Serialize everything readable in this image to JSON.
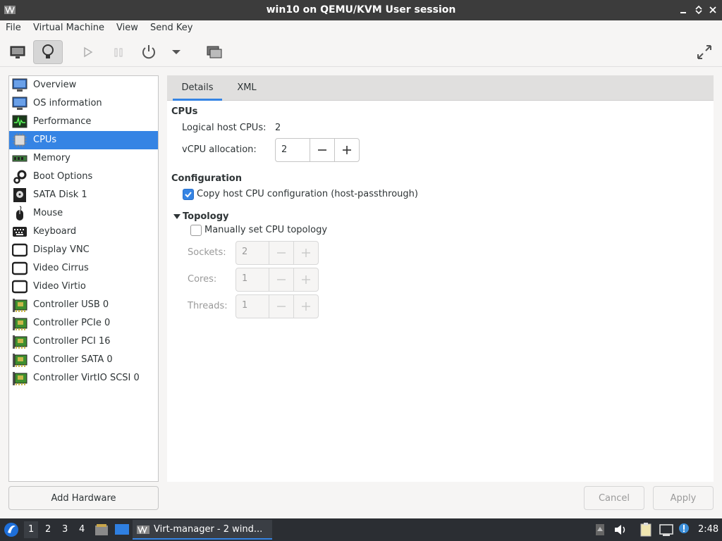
{
  "window": {
    "title": "win10 on QEMU/KVM User session"
  },
  "menu": [
    "File",
    "Virtual Machine",
    "View",
    "Send Key"
  ],
  "toolbar": {
    "icons": [
      "console-icon",
      "details-lightbulb-icon",
      "run-icon",
      "pause-icon",
      "power-icon",
      "power-menu-chevron-icon",
      "snapshots-icon",
      "fullscreen-icon"
    ]
  },
  "sidebar": {
    "items": [
      {
        "label": "Overview",
        "icon": "monitor-icon"
      },
      {
        "label": "OS information",
        "icon": "monitor-icon"
      },
      {
        "label": "Performance",
        "icon": "performance-graph-icon"
      },
      {
        "label": "CPUs",
        "icon": "cpu-chip-icon",
        "selected": true
      },
      {
        "label": "Memory",
        "icon": "memory-icon"
      },
      {
        "label": "Boot Options",
        "icon": "gears-icon"
      },
      {
        "label": "SATA Disk 1",
        "icon": "disk-icon"
      },
      {
        "label": "Mouse",
        "icon": "mouse-icon"
      },
      {
        "label": "Keyboard",
        "icon": "keyboard-icon"
      },
      {
        "label": "Display VNC",
        "icon": "display-icon"
      },
      {
        "label": "Video Cirrus",
        "icon": "display-icon"
      },
      {
        "label": "Video Virtio",
        "icon": "display-icon"
      },
      {
        "label": "Controller USB 0",
        "icon": "controller-card-icon"
      },
      {
        "label": "Controller PCIe 0",
        "icon": "controller-card-icon"
      },
      {
        "label": "Controller PCI 16",
        "icon": "controller-card-icon"
      },
      {
        "label": "Controller SATA 0",
        "icon": "controller-card-icon"
      },
      {
        "label": "Controller VirtIO SCSI 0",
        "icon": "controller-card-icon"
      }
    ],
    "add_hardware": "Add Hardware"
  },
  "tabs": [
    "Details",
    "XML"
  ],
  "cpus": {
    "section_title": "CPUs",
    "logical_label": "Logical host CPUs:",
    "logical_value": "2",
    "vcpu_label": "vCPU allocation:",
    "vcpu_value": "2"
  },
  "configuration": {
    "title": "Configuration",
    "copy_host_label": "Copy host CPU configuration (host-passthrough)",
    "copy_host_checked": true
  },
  "topology": {
    "title": "Topology",
    "manual_label": "Manually set CPU topology",
    "manual_checked": false,
    "sockets_label": "Sockets:",
    "sockets_value": "2",
    "cores_label": "Cores:",
    "cores_value": "1",
    "threads_label": "Threads:",
    "threads_value": "1"
  },
  "buttons": {
    "cancel": "Cancel",
    "apply": "Apply"
  },
  "taskbar": {
    "workspaces": [
      "1",
      "2",
      "3",
      "4"
    ],
    "task_label": "Virt-manager - 2 wind...",
    "clock": "2:48"
  },
  "colors": {
    "accent": "#3584e4",
    "titlebar": "#3c3c3c",
    "taskbar": "#2b2e33"
  }
}
